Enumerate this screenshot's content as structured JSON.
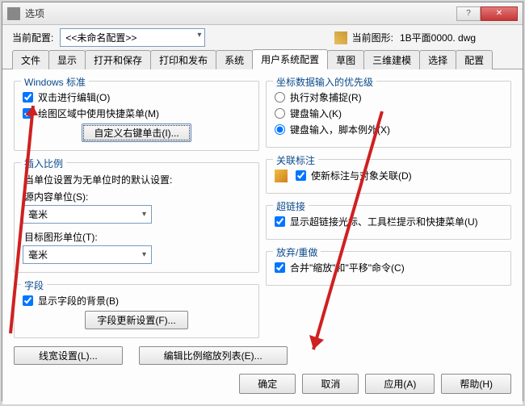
{
  "titlebar": {
    "title": "选项"
  },
  "toprow": {
    "label_current": "当前配置:",
    "combo_value": "<<未命名配置>>",
    "label_drawing": "当前图形:",
    "drawing_value": "1B平面0000. dwg"
  },
  "tabs": [
    "文件",
    "显示",
    "打开和保存",
    "打印和发布",
    "系统",
    "用户系统配置",
    "草图",
    "三维建模",
    "选择",
    "配置"
  ],
  "active_tab_index": 5,
  "left": {
    "g1": {
      "title": "Windows 标准",
      "chk1": "双击进行编辑(O)",
      "chk2": "绘图区域中使用快捷菜单(M)",
      "btn": "自定义右键单击(I)..."
    },
    "g2": {
      "title": "插入比例",
      "desc": "当单位设置为无单位时的默认设置:",
      "lbl1": "源内容单位(S):",
      "sel1": "毫米",
      "lbl2": "目标图形单位(T):",
      "sel2": "毫米"
    },
    "g3": {
      "title": "字段",
      "chk": "显示字段的背景(B)",
      "btn": "字段更新设置(F)..."
    },
    "btn_lw": "线宽设置(L)...",
    "btn_scale": "编辑比例缩放列表(E)..."
  },
  "right": {
    "g1": {
      "title": "坐标数据输入的优先级",
      "r1": "执行对象捕捉(R)",
      "r2": "键盘输入(K)",
      "r3": "键盘输入，脚本例外(X)"
    },
    "g2": {
      "title": "关联标注",
      "chk": "使新标注与对象关联(D)"
    },
    "g3": {
      "title": "超链接",
      "chk": "显示超链接光标、工具栏提示和快捷菜单(U)"
    },
    "g4": {
      "title": "放弃/重做",
      "chk": "合并\"缩放\"和\"平移\"命令(C)"
    }
  },
  "dlg": {
    "ok": "确定",
    "cancel": "取消",
    "apply": "应用(A)",
    "help": "帮助(H)"
  }
}
